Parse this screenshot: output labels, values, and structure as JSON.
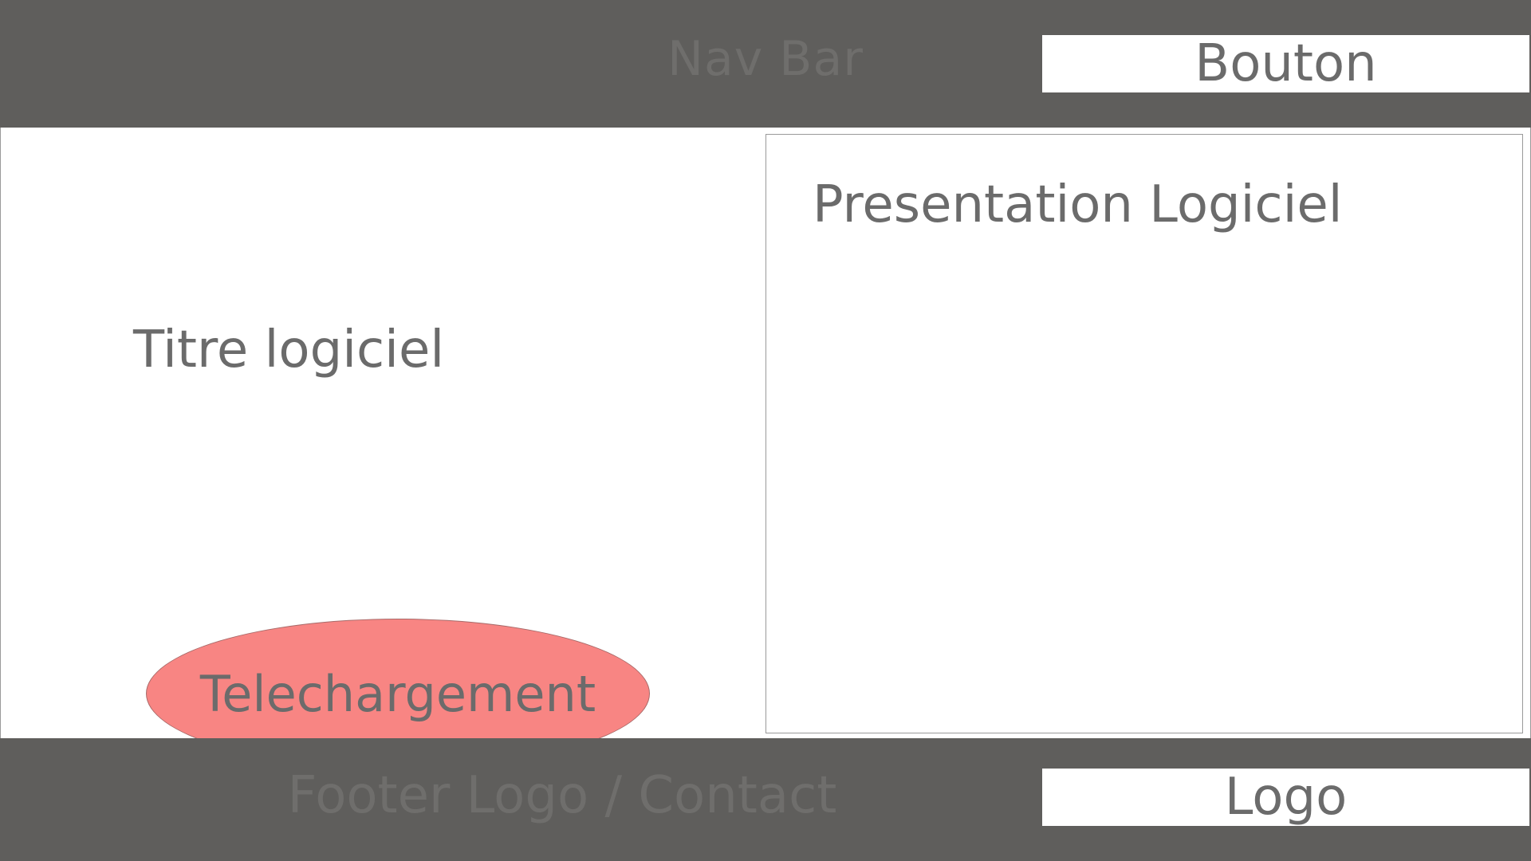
{
  "header": {
    "label": "Nav Bar",
    "button_label": "Bouton"
  },
  "main": {
    "title": "Titre logiciel",
    "download_label": "Telechargement",
    "presentation_title": "Presentation Logiciel"
  },
  "footer": {
    "label": "Footer Logo / Contact",
    "logo_label": "Logo"
  },
  "colors": {
    "bar_background": "#5f5e5c",
    "download_button": "#f88583",
    "text": "#6b6b6b"
  }
}
